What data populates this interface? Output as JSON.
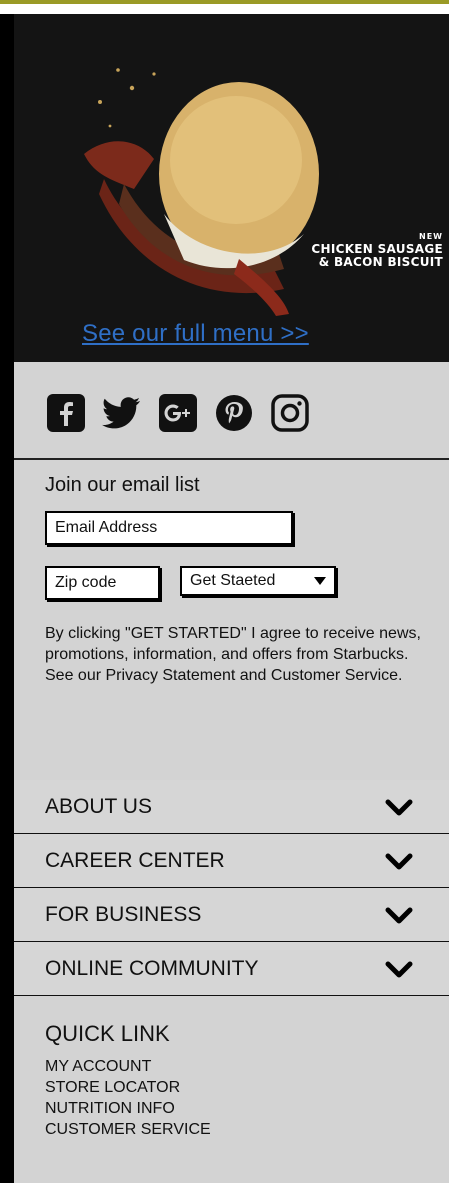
{
  "hero": {
    "product_new": "NEW",
    "product_line1": "CHICKEN SAUSAGE",
    "product_line2": "& BACON BISCUIT",
    "menu_link": "See our full menu >>"
  },
  "social": {
    "items": [
      {
        "name": "facebook-icon"
      },
      {
        "name": "twitter-icon"
      },
      {
        "name": "google-plus-icon"
      },
      {
        "name": "pinterest-icon"
      },
      {
        "name": "instagram-icon"
      }
    ]
  },
  "signup": {
    "title": "Join our email list",
    "email_placeholder": "Email Address",
    "zip_placeholder": "Zip code",
    "select_value": "Get Staeted",
    "agree_text": "By clicking \"GET STARTED\" I agree to receive news, promotions, information, and offers from Starbucks. See our Privacy Statement and Customer Service."
  },
  "accordion": {
    "items": [
      {
        "label": "ABOUT US"
      },
      {
        "label": "CAREER CENTER"
      },
      {
        "label": "FOR BUSINESS"
      },
      {
        "label": "ONLINE COMMUNITY"
      }
    ]
  },
  "quick_links": {
    "title": "QUICK LINK",
    "items": [
      "MY ACCOUNT",
      "STORE LOCATOR",
      "NUTRITION INFO",
      "CUSTOMER SERVICE"
    ]
  },
  "colors": {
    "accent_gold": "#9a9a26",
    "link_blue": "#2f6fc6",
    "panel_gray": "#d3d3d3"
  }
}
